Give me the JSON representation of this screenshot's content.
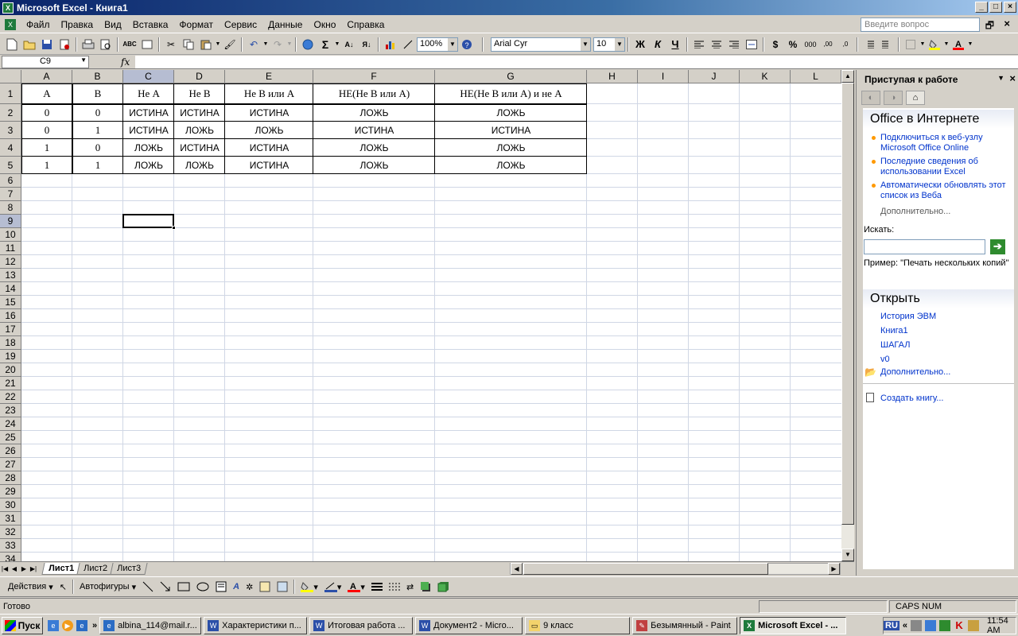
{
  "window": {
    "title": "Microsoft Excel - Книга1",
    "min": "_",
    "max": "□",
    "close": "×",
    "doc_restore": "🗗",
    "doc_close": "×"
  },
  "menu": [
    "Файл",
    "Правка",
    "Вид",
    "Вставка",
    "Формат",
    "Сервис",
    "Данные",
    "Окно",
    "Справка"
  ],
  "help_placeholder": "Введите вопрос",
  "toolbar": {
    "zoom": "100%",
    "font": "Arial Cyr",
    "size": "10",
    "bold": "Ж",
    "italic": "К",
    "underline": "Ч",
    "currency": "$",
    "percent": "%",
    "thousands": "000",
    "sum": "Σ"
  },
  "formula_bar": {
    "name_box": "C9",
    "fx": "fx",
    "value": ""
  },
  "columns": [
    "A",
    "B",
    "C",
    "D",
    "E",
    "F",
    "G",
    "H",
    "I",
    "J",
    "K",
    "L"
  ],
  "selected_column": "C",
  "rows": [
    "1",
    "2",
    "3",
    "4",
    "5",
    "6",
    "7",
    "8",
    "9",
    "10",
    "11",
    "12",
    "13",
    "14",
    "15",
    "16",
    "17",
    "18",
    "19",
    "20",
    "21",
    "22",
    "23",
    "24",
    "25",
    "26",
    "27",
    "28",
    "29",
    "30",
    "31",
    "32",
    "33",
    "34"
  ],
  "selected_row": "9",
  "table": {
    "header": [
      "A",
      "B",
      "Не А",
      "Не В",
      "Не В или А",
      "НЕ(Не В или А)",
      "НЕ(Не В или А)  и не А"
    ],
    "data": [
      [
        "0",
        "0",
        "ИСТИНА",
        "ИСТИНА",
        "ИСТИНА",
        "ЛОЖЬ",
        "ЛОЖЬ"
      ],
      [
        "0",
        "1",
        "ИСТИНА",
        "ЛОЖЬ",
        "ЛОЖЬ",
        "ИСТИНА",
        "ИСТИНА"
      ],
      [
        "1",
        "0",
        "ЛОЖЬ",
        "ИСТИНА",
        "ИСТИНА",
        "ЛОЖЬ",
        "ЛОЖЬ"
      ],
      [
        "1",
        "1",
        "ЛОЖЬ",
        "ЛОЖЬ",
        "ИСТИНА",
        "ЛОЖЬ",
        "ЛОЖЬ"
      ]
    ]
  },
  "sheet_tabs": [
    "Лист1",
    "Лист2",
    "Лист3"
  ],
  "active_tab": "Лист1",
  "drawing_toolbar": {
    "actions": "Действия",
    "autoshapes": "Автофигуры"
  },
  "status": {
    "ready": "Готово",
    "indicators": "CAPS NUM"
  },
  "task_pane": {
    "title": "Приступая к работе",
    "online_section": "Office в Интернете",
    "online_links": [
      "Подключиться к веб-узлу Microsoft Office Online",
      "Последние сведения об использовании Excel",
      "Автоматически обновлять этот список из Веба"
    ],
    "more_online": "Дополнительно...",
    "search_label": "Искать:",
    "example": "Пример:  \"Печать нескольких копий\"",
    "open_section": "Открыть",
    "recent_files": [
      "История ЭВМ",
      "Книга1",
      "ШАГАЛ",
      "v0"
    ],
    "more_files": "Дополнительно...",
    "create": "Создать книгу..."
  },
  "taskbar": {
    "start": "Пуск",
    "items": [
      "albina_114@mail.r...",
      "Характеристики п...",
      "Итоговая работа ...",
      "Документ2 - Micro...",
      "9 класс",
      "Безымянный - Paint",
      "Microsoft Excel - ..."
    ],
    "active_index": 6,
    "lang": "RU",
    "clock": "11:54 AM"
  }
}
